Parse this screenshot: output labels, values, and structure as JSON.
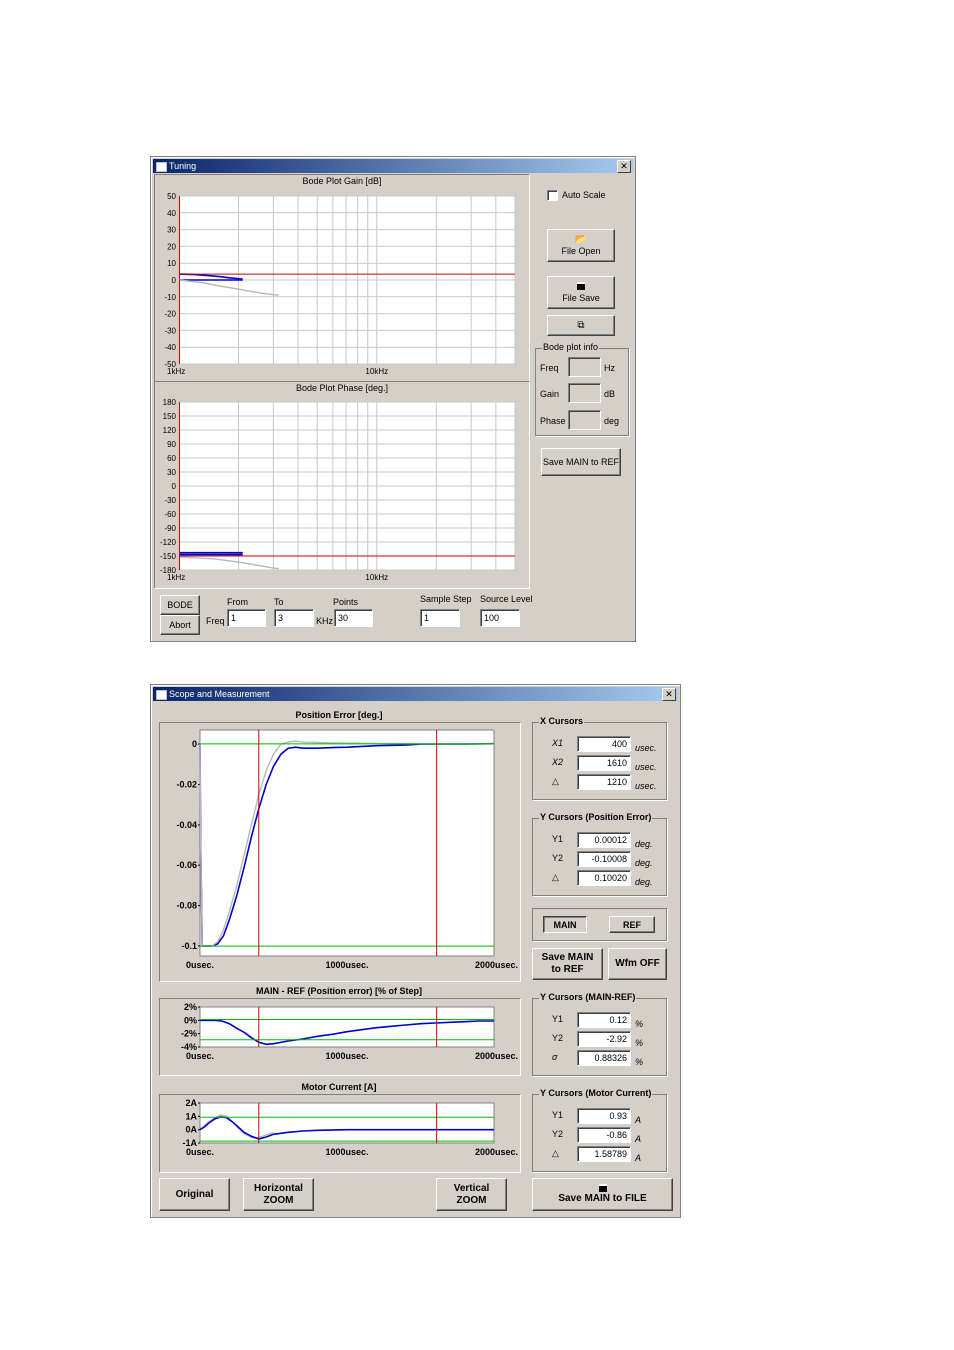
{
  "tuning": {
    "title": "Tuning",
    "gain_chart_title": "Bode Plot Gain [dB]",
    "phase_chart_title": "Bode Plot Phase [deg.]",
    "auto_scale_label": "Auto Scale",
    "file_open_label": "File Open",
    "file_save_label": "File Save",
    "bode_info": {
      "caption": "Bode plot info",
      "freq_label": "Freq",
      "freq_unit": "Hz",
      "gain_label": "Gain",
      "gain_unit": "dB",
      "phase_label": "Phase",
      "phase_unit": "deg"
    },
    "save_main_to_ref": "Save MAIN to REF",
    "bode_button": "BODE",
    "abort_button": "Abort",
    "freq_label": "Freq",
    "khz_label": "KHz",
    "from_label": "From",
    "from_value": "1",
    "to_label": "To",
    "to_value": "3",
    "points_label": "Points",
    "points_value": "30",
    "sample_step_label": "Sample Step",
    "sample_step_value": "1",
    "source_level_label": "Source Level",
    "source_level_value": "100"
  },
  "scope": {
    "title": "Scope and Measurement",
    "pos_chart_title": "Position Error [deg.]",
    "diff_chart_title": "MAIN - REF (Position error) [% of Step]",
    "current_chart_title": "Motor Current [A]",
    "x_cursors": {
      "caption": "X Cursors",
      "x1_label": "X1",
      "x1": "400",
      "x2_label": "X2",
      "x2": "1610",
      "d_label": "△",
      "d": "1210",
      "unit": "usec."
    },
    "y_cursors_pos": {
      "caption": "Y Cursors (Position Error)",
      "y1_label": "Y1",
      "y1": "0.00012",
      "y2_label": "Y2",
      "y2": "-0.10008",
      "d_label": "△",
      "d": "0.10020",
      "unit": "deg."
    },
    "main_button": "MAIN",
    "ref_button": "REF",
    "save_main_ref_l1": "Save MAIN",
    "save_main_ref_l2": "to REF",
    "wfm_off": "Wfm OFF",
    "y_cursors_diff": {
      "caption": "Y Cursors (MAIN-REF)",
      "y1_label": "Y1",
      "y1": "0.12",
      "y2_label": "Y2",
      "y2": "-2.92",
      "s_label": "σ",
      "s": "0.88326",
      "unit": "%"
    },
    "y_cursors_cur": {
      "caption": "Y Cursors (Motor Current)",
      "y1_label": "Y1",
      "y1": "0.93",
      "y2_label": "Y2",
      "y2": "-0.86",
      "d_label": "△",
      "d": "1.58789",
      "unit": "A"
    },
    "original_button": "Original",
    "hzoom_l1": "Horizontal",
    "hzoom_l2": "ZOOM",
    "vzoom_l1": "Vertical",
    "vzoom_l2": "ZOOM",
    "save_file_label": "Save MAIN to FILE"
  },
  "colors": {
    "main": "#0000cc",
    "ref": "#b8b8b8",
    "cursor_red": "#cc0000",
    "cursor_green": "#00bb00",
    "grid": "#c8c8c8"
  },
  "chart_data": [
    {
      "id": "gain",
      "type": "line",
      "title": "Bode Plot Gain [dB]",
      "xscale": "log",
      "xlim": [
        1,
        50
      ],
      "ylim": [
        -50,
        50
      ],
      "yticks": [
        50,
        40,
        30,
        20,
        10,
        0,
        -10,
        -20,
        -30,
        -40,
        -50
      ],
      "xtick_labels": [
        {
          "x": 1,
          "label": "1kHz"
        },
        {
          "x": 10,
          "label": "10kHz"
        }
      ],
      "grid": true,
      "cursors": {
        "vertical": [
          1
        ],
        "horizontal": [
          3.5
        ]
      },
      "series": [
        {
          "role": "main",
          "x": [
            1,
            1.2,
            1.4,
            1.6,
            1.8,
            2.0,
            2.1
          ],
          "y": [
            3.5,
            3.2,
            2.6,
            2,
            1.3,
            0.8,
            0.5
          ]
        },
        {
          "role": "main",
          "x": [
            1,
            2.1
          ],
          "y": [
            0,
            0
          ]
        },
        {
          "role": "ref",
          "x": [
            1,
            1.3,
            1.6,
            2.0,
            2.5,
            3.0,
            3.2
          ],
          "y": [
            0,
            -1.5,
            -3.5,
            -5.5,
            -7.5,
            -8.8,
            -9
          ]
        }
      ]
    },
    {
      "id": "phase",
      "type": "line",
      "title": "Bode Plot Phase [deg.]",
      "xscale": "log",
      "xlim": [
        1,
        50
      ],
      "ylim": [
        -180,
        180
      ],
      "yticks": [
        180,
        150,
        120,
        90,
        60,
        30,
        0,
        -30,
        -60,
        -90,
        -120,
        -150,
        -180
      ],
      "xtick_labels": [
        {
          "x": 1,
          "label": "1kHz"
        },
        {
          "x": 10,
          "label": "10kHz"
        }
      ],
      "grid": true,
      "cursors": {
        "vertical": [
          1
        ],
        "horizontal": [
          -150
        ]
      },
      "series": [
        {
          "role": "main",
          "x": [
            1,
            2.1
          ],
          "y": [
            -143,
            -143
          ]
        },
        {
          "role": "main",
          "x": [
            1,
            2.1
          ],
          "y": [
            -147,
            -147
          ]
        },
        {
          "role": "ref",
          "x": [
            1,
            1.5,
            2.0,
            2.5,
            3.0,
            3.2
          ],
          "y": [
            -152,
            -156,
            -163,
            -170,
            -176,
            -177
          ]
        }
      ]
    },
    {
      "id": "position",
      "type": "line",
      "title": "Position Error [deg.]",
      "xlim": [
        0,
        2000
      ],
      "ylim": [
        -0.105,
        0.007
      ],
      "yticks": [
        0,
        -0.02,
        -0.04,
        -0.06,
        -0.08,
        -0.1
      ],
      "ytick_labels": [
        "0",
        "-0.02",
        "-0.04",
        "-0.06",
        "-0.08",
        "-0.1"
      ],
      "xtick_labels": [
        {
          "x": 0,
          "label": "0usec."
        },
        {
          "x": 1000,
          "label": "1000usec."
        },
        {
          "x": 2000,
          "label": "2000usec."
        }
      ],
      "grid": false,
      "cursors": {
        "vertical": [
          400,
          1610
        ],
        "horizontal": [
          0.00012,
          -0.10008
        ]
      },
      "series": [
        {
          "role": "main",
          "x": [
            0,
            5,
            15,
            40,
            80,
            120,
            160,
            200,
            250,
            300,
            350,
            400,
            450,
            500,
            550,
            600,
            650,
            700,
            800,
            900,
            1000,
            1200,
            1400,
            1500,
            1600,
            1800,
            2000
          ],
          "y": [
            0,
            -0.05,
            -0.1,
            -0.1,
            -0.1,
            -0.099,
            -0.095,
            -0.087,
            -0.075,
            -0.061,
            -0.046,
            -0.032,
            -0.02,
            -0.011,
            -0.005,
            -0.002,
            -0.0015,
            -0.002,
            -0.002,
            -0.0017,
            -0.0015,
            -0.0008,
            -0.0005,
            0,
            0,
            0,
            0.0002
          ]
        },
        {
          "role": "ref",
          "x": [
            0,
            5,
            15,
            40,
            80,
            120,
            160,
            200,
            250,
            300,
            350,
            400,
            450,
            500,
            550,
            600,
            650,
            700,
            800,
            900,
            1000,
            1200,
            1400,
            1600,
            1800,
            2000
          ],
          "y": [
            0,
            -0.05,
            -0.1,
            -0.1,
            -0.1,
            -0.098,
            -0.092,
            -0.083,
            -0.07,
            -0.055,
            -0.04,
            -0.025,
            -0.013,
            -0.005,
            0,
            0.001,
            0.0015,
            0.001,
            0.0008,
            0.0006,
            0.0005,
            0.0003,
            0.0002,
            0.0001,
            0.0001,
            0.0001
          ]
        }
      ]
    },
    {
      "id": "diff",
      "type": "line",
      "title": "MAIN - REF (Position error) [% of Step]",
      "xlim": [
        0,
        2000
      ],
      "ylim": [
        -4,
        2
      ],
      "yticks": [
        2,
        0,
        -2,
        -4
      ],
      "ytick_labels": [
        "2%",
        "0%",
        "-2%",
        "-4%"
      ],
      "xtick_labels": [
        {
          "x": 0,
          "label": "0usec."
        },
        {
          "x": 1000,
          "label": "1000usec."
        },
        {
          "x": 2000,
          "label": "2000usec."
        }
      ],
      "grid": false,
      "cursors": {
        "vertical": [
          400,
          1610
        ],
        "horizontal": [
          0.12,
          -2.92
        ]
      },
      "series": [
        {
          "role": "main",
          "x": [
            0,
            100,
            150,
            200,
            250,
            300,
            350,
            400,
            450,
            500,
            600,
            700,
            800,
            900,
            1000,
            1100,
            1200,
            1300,
            1400,
            1500,
            1600,
            1700,
            1800,
            1900,
            2000
          ],
          "y": [
            0,
            0,
            -0.1,
            -0.5,
            -1.2,
            -1.8,
            -2.6,
            -3.3,
            -3.6,
            -3.5,
            -3.1,
            -2.8,
            -2.4,
            -2.1,
            -1.7,
            -1.4,
            -1.1,
            -0.9,
            -0.7,
            -0.5,
            -0.4,
            -0.3,
            -0.2,
            -0.1,
            -0.1
          ]
        }
      ]
    },
    {
      "id": "current",
      "type": "line",
      "title": "Motor Current [A]",
      "xlim": [
        0,
        2000
      ],
      "ylim": [
        -1,
        2
      ],
      "yticks": [
        2,
        1,
        0,
        -1
      ],
      "ytick_labels": [
        "2A",
        "1A",
        "0A",
        "-1A"
      ],
      "xtick_labels": [
        {
          "x": 0,
          "label": "0usec."
        },
        {
          "x": 1000,
          "label": "1000usec."
        },
        {
          "x": 2000,
          "label": "2000usec."
        }
      ],
      "grid": false,
      "cursors": {
        "vertical": [
          400,
          1610
        ],
        "horizontal": [
          0.93,
          -0.86
        ]
      },
      "series": [
        {
          "role": "ref",
          "x": [
            0,
            30,
            60,
            100,
            140,
            180,
            220,
            260,
            300,
            350,
            400,
            450,
            500
          ],
          "y": [
            0,
            0.3,
            0.6,
            0.9,
            1.1,
            1.0,
            0.6,
            0.1,
            -0.3,
            -0.6,
            -0.6,
            -0.4,
            -0.2
          ]
        },
        {
          "role": "main",
          "x": [
            0,
            30,
            60,
            100,
            140,
            180,
            220,
            260,
            300,
            350,
            400,
            450,
            500,
            600,
            700,
            800,
            1000,
            1200,
            1400,
            1600,
            1800,
            2000
          ],
          "y": [
            0,
            0.2,
            0.5,
            0.8,
            0.95,
            0.9,
            0.6,
            0.2,
            -0.2,
            -0.5,
            -0.7,
            -0.55,
            -0.35,
            -0.2,
            -0.1,
            -0.05,
            0,
            0,
            0,
            0,
            0,
            0
          ]
        }
      ]
    }
  ]
}
